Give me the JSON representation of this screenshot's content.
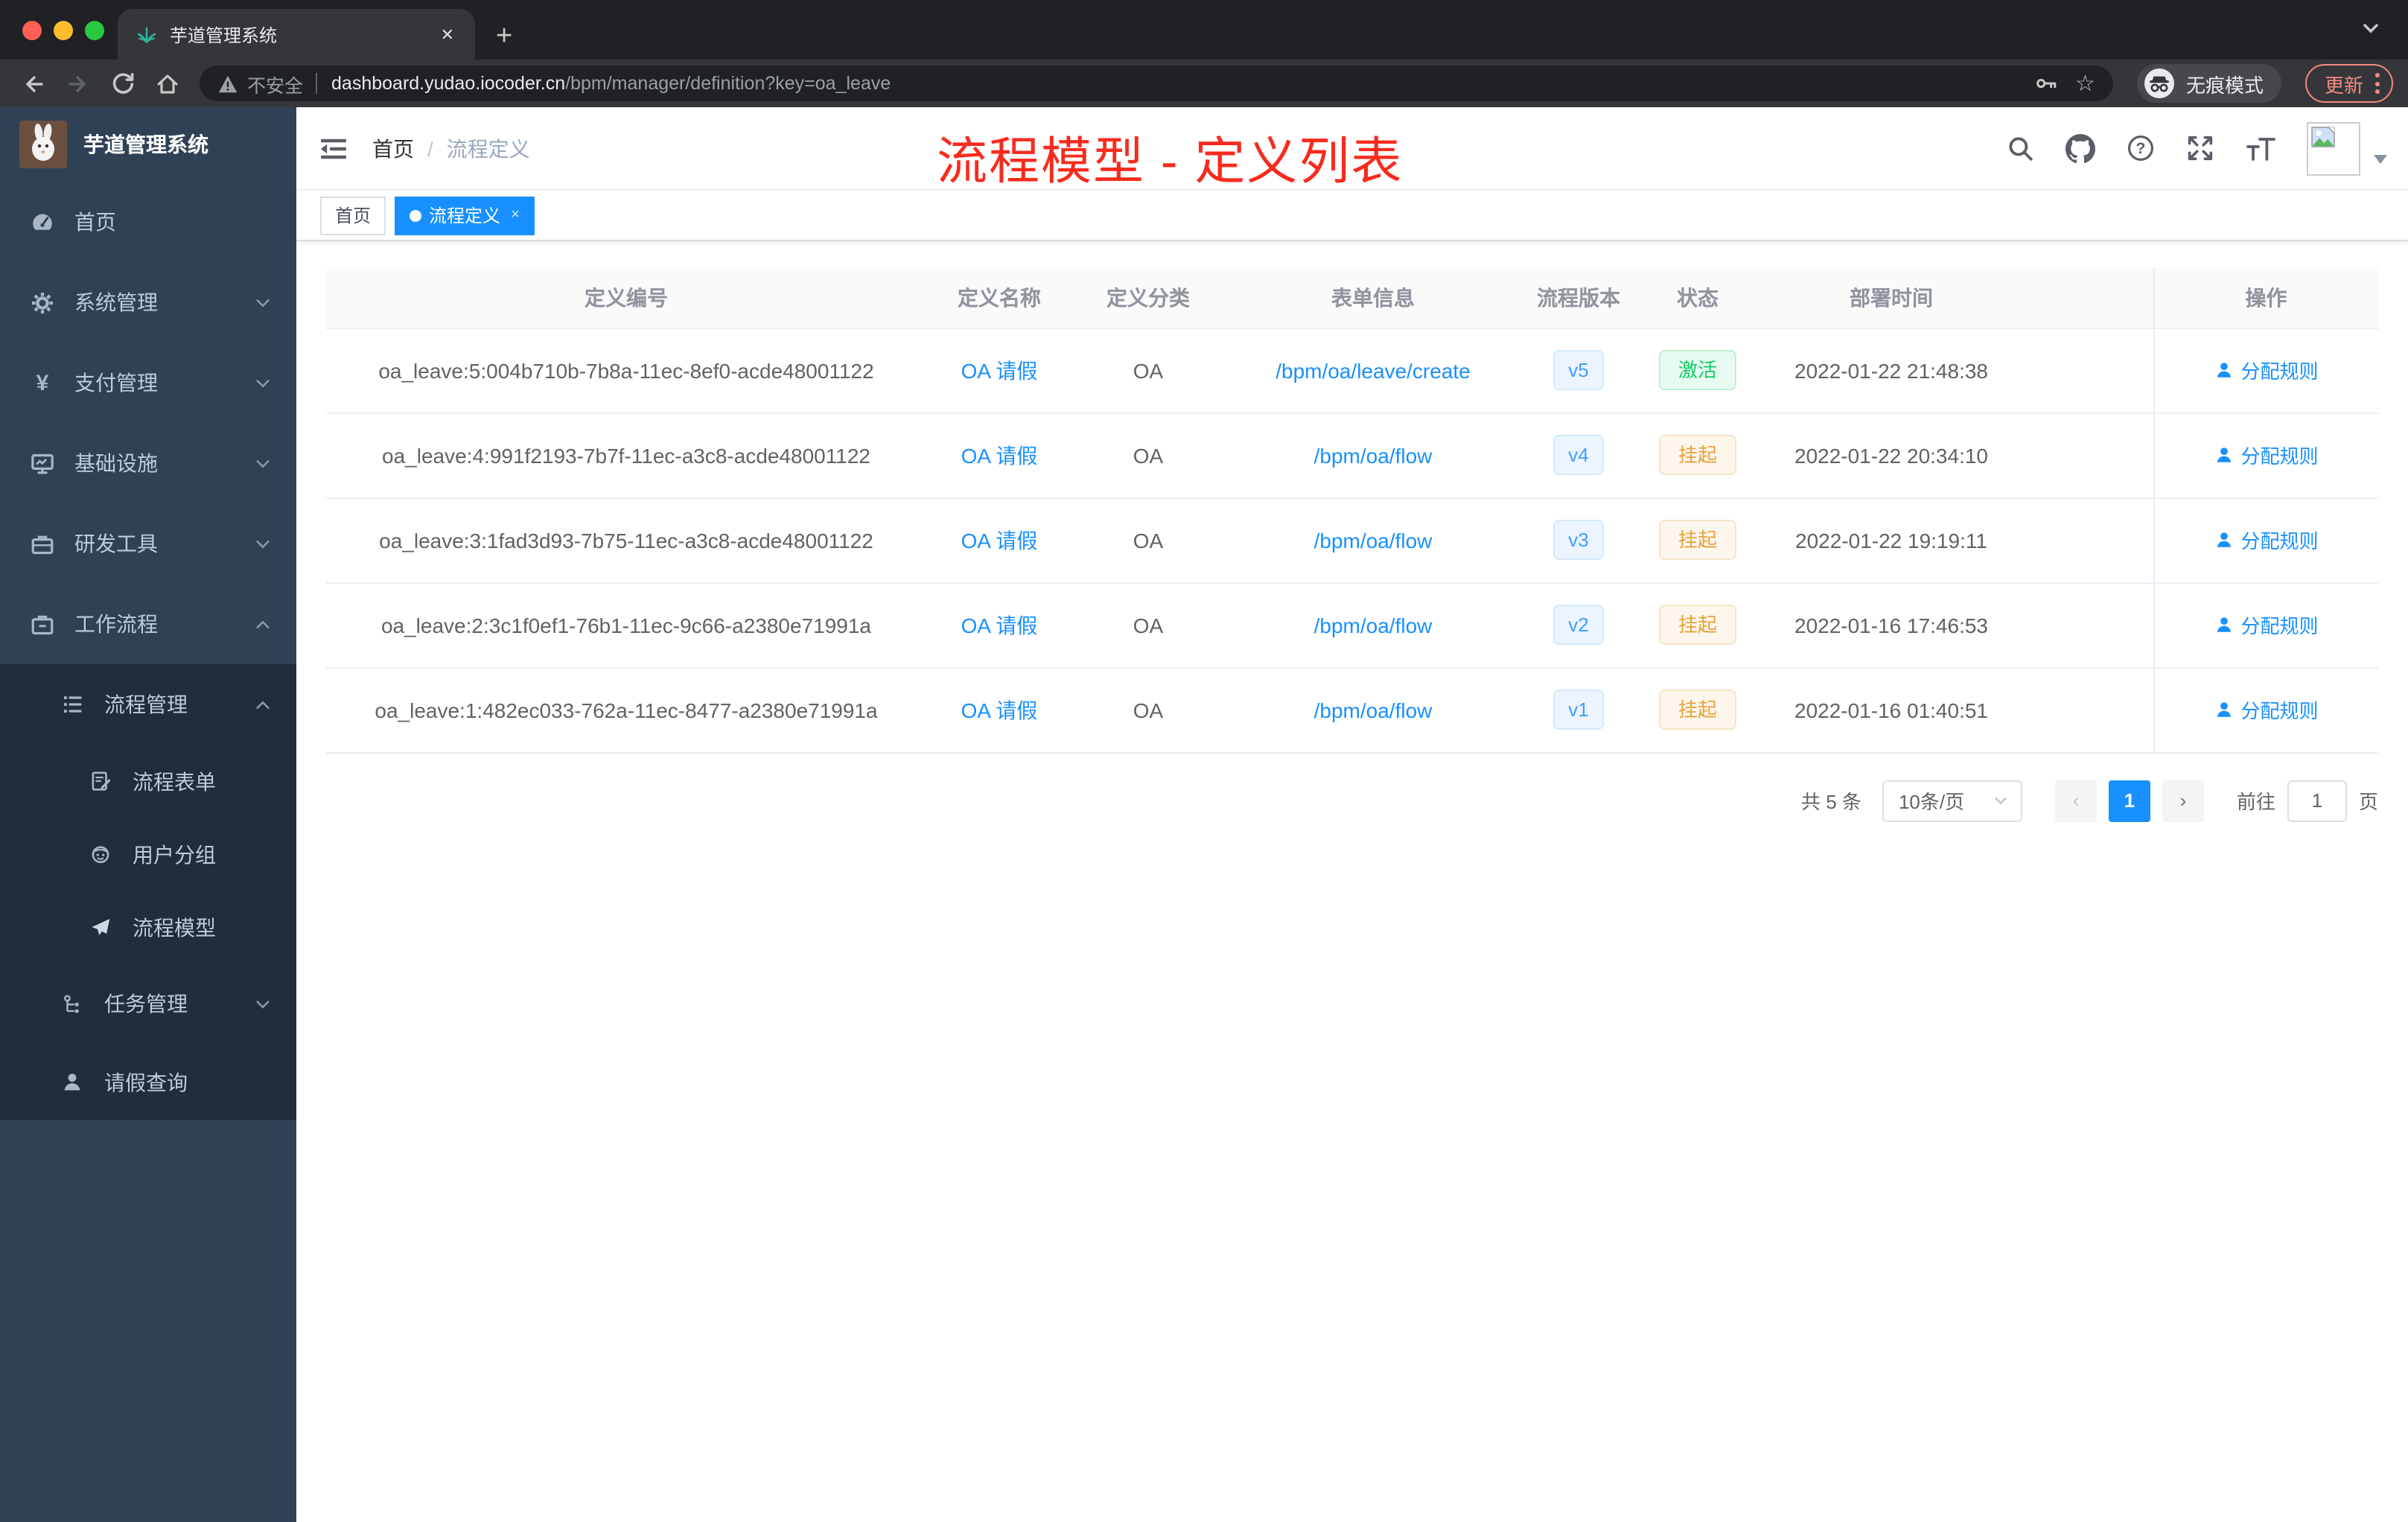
{
  "colors": {
    "accent_blue": "#1890ff",
    "element_blue": "#409eff",
    "success_green": "#13ce66",
    "warning_orange": "#e6a23c",
    "sidebar_bg": "#304156",
    "submenu_bg": "#1f2d3d",
    "annotation_red": "#f82b1d",
    "active_tag_bg": "#1890ff"
  },
  "browser": {
    "tab_title": "芋道管理系统",
    "tab_close_glyph": "✕",
    "new_tab_glyph": "+",
    "security_label": "不安全",
    "url_host": "dashboard.yudao.iocoder.cn",
    "url_path": "/bpm/manager/definition?key=oa_leave",
    "star_glyph": "☆",
    "incognito_label": "无痕模式",
    "update_label": "更新"
  },
  "sidebar": {
    "app_title": "芋道管理系统",
    "items": [
      {
        "label": "首页"
      },
      {
        "label": "系统管理"
      },
      {
        "label": "支付管理"
      },
      {
        "label": "基础设施"
      },
      {
        "label": "研发工具"
      },
      {
        "label": "工作流程"
      }
    ],
    "workflow_children": [
      {
        "label": "流程管理"
      },
      {
        "label": "流程表单"
      },
      {
        "label": "用户分组"
      },
      {
        "label": "流程模型"
      },
      {
        "label": "任务管理"
      },
      {
        "label": "请假查询"
      }
    ],
    "yen_glyph": "¥"
  },
  "navbar": {
    "breadcrumb": {
      "home": "首页",
      "separator": "/",
      "current": "流程定义"
    },
    "annotation": "流程模型 - 定义列表",
    "help_glyph": "?"
  },
  "tags": {
    "home": "首页",
    "active": "流程定义",
    "close_glyph": "×"
  },
  "table": {
    "columns": [
      "定义编号",
      "定义名称",
      "定义分类",
      "表单信息",
      "流程版本",
      "状态",
      "部署时间",
      "操作"
    ],
    "rows": [
      {
        "id": "oa_leave:5:004b710b-7b8a-11ec-8ef0-acde48001122",
        "name": "OA 请假",
        "category": "OA",
        "form": "/bpm/oa/leave/create",
        "version": "v5",
        "status": "激活",
        "deploy_time": "2022-01-22 21:48:38",
        "action": "分配规则"
      },
      {
        "id": "oa_leave:4:991f2193-7b7f-11ec-a3c8-acde48001122",
        "name": "OA 请假",
        "category": "OA",
        "form": "/bpm/oa/flow",
        "version": "v4",
        "status": "挂起",
        "deploy_time": "2022-01-22 20:34:10",
        "action": "分配规则"
      },
      {
        "id": "oa_leave:3:1fad3d93-7b75-11ec-a3c8-acde48001122",
        "name": "OA 请假",
        "category": "OA",
        "form": "/bpm/oa/flow",
        "version": "v3",
        "status": "挂起",
        "deploy_time": "2022-01-22 19:19:11",
        "action": "分配规则"
      },
      {
        "id": "oa_leave:2:3c1f0ef1-76b1-11ec-9c66-a2380e71991a",
        "name": "OA 请假",
        "category": "OA",
        "form": "/bpm/oa/flow",
        "version": "v2",
        "status": "挂起",
        "deploy_time": "2022-01-16 17:46:53",
        "action": "分配规则"
      },
      {
        "id": "oa_leave:1:482ec033-762a-11ec-8477-a2380e71991a",
        "name": "OA 请假",
        "category": "OA",
        "form": "/bpm/oa/flow",
        "version": "v1",
        "status": "挂起",
        "deploy_time": "2022-01-16 01:40:51",
        "action": "分配规则"
      }
    ]
  },
  "pagination": {
    "total": "共 5 条",
    "page_size": "10条/页",
    "prev_glyph": "‹",
    "current_page": "1",
    "next_glyph": "›",
    "goto_label": "前往",
    "goto_value": "1",
    "page_unit": "页"
  }
}
